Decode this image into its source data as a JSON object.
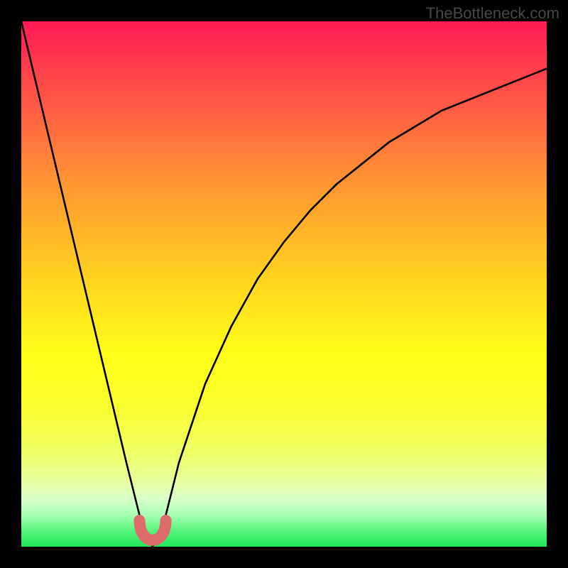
{
  "attribution": "TheBottleneck.com",
  "chart_data": {
    "type": "line",
    "title": "",
    "xlabel": "",
    "ylabel": "",
    "xlim": [
      0,
      100
    ],
    "ylim": [
      0,
      100
    ],
    "x": [
      0,
      5,
      10,
      15,
      20,
      23,
      25,
      27,
      30,
      35,
      40,
      45,
      50,
      55,
      60,
      65,
      70,
      75,
      80,
      85,
      90,
      95,
      100
    ],
    "series": [
      {
        "name": "bottleneck_curve",
        "values": [
          100,
          79,
          58,
          37,
          16,
          4,
          0,
          4,
          16,
          31,
          42,
          51,
          58,
          64,
          69,
          73,
          77,
          80,
          83,
          85,
          87,
          89,
          91
        ]
      }
    ],
    "highlight_region": {
      "x": [
        22.5,
        27.5
      ],
      "y": [
        5,
        0,
        5
      ],
      "color": "#dd6b6b"
    },
    "gradient_stops": [
      {
        "pos": 0,
        "color": "#ff1a55"
      },
      {
        "pos": 50,
        "color": "#ffe81c"
      },
      {
        "pos": 100,
        "color": "#1fe65c"
      }
    ]
  }
}
